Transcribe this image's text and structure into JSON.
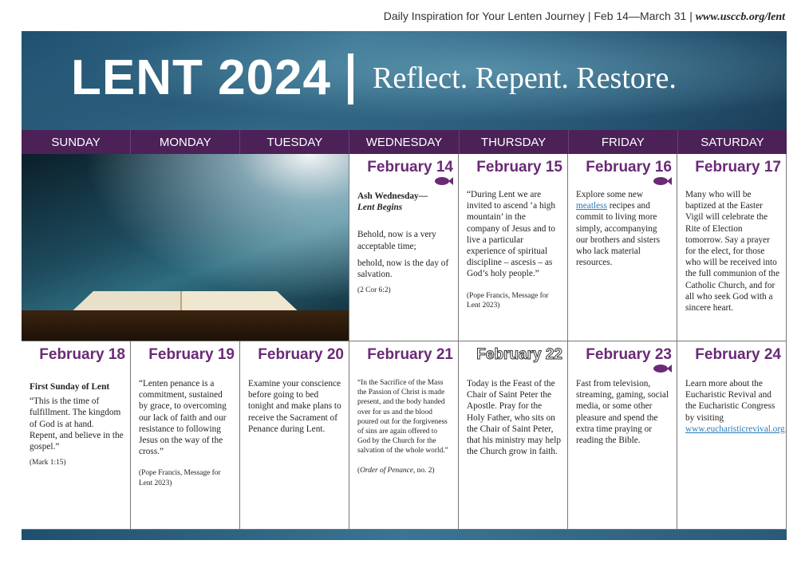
{
  "header": {
    "tagline": "Daily Inspiration for Your Lenten Journey | Feb 14—March 31 |",
    "site": "www.usccb.org/lent"
  },
  "banner": {
    "title": "LENT 2024",
    "subtitle": "Reflect. Repent. Restore."
  },
  "days": [
    "SUNDAY",
    "MONDAY",
    "TUESDAY",
    "WEDNESDAY",
    "THURSDAY",
    "FRIDAY",
    "SATURDAY"
  ],
  "colors": {
    "purple": "#4b2158",
    "date_purple": "#6a2a76",
    "link": "#2a7bb8"
  },
  "icons": {
    "meatless_day": "fish-icon"
  },
  "week1": {
    "feb14": {
      "date": "February 14",
      "heading": "Ash Wednesday—",
      "subheading": "Lent Begins",
      "line1": "Behold, now is a very acceptable time;",
      "line2": "behold, now is the day of salvation.",
      "cite": "(2 Cor 6:2)"
    },
    "feb15": {
      "date": "February 15",
      "quote": "“During Lent we are invited to ascend ‘a high mountain’ in the company of Jesus and to live a particular experience of spiritual discipline – ascesis – as God’s holy people.”",
      "cite": "(Pope Francis, Message for Lent 2023)"
    },
    "feb16": {
      "date": "February 16",
      "text_pre": "Explore some new",
      "link": "meatless",
      "text_post": "recipes and commit to living more simply, accompanying our brothers and sisters who lack material resources."
    },
    "feb17": {
      "date": "February 17",
      "text": "Many who will be baptized at the Easter Vigil will celebrate the Rite of Election tomorrow. Say a prayer for the elect, for those who will be received into the full communion of the Catholic Church, and for all who seek God with a sincere heart."
    }
  },
  "week2": {
    "feb18": {
      "date": "February 18",
      "heading": "First Sunday of Lent",
      "quote": "“This is the time of fulfillment. The kingdom of God is at hand. Repent, and believe in the gospel.”",
      "cite": "(Mark 1:15)"
    },
    "feb19": {
      "date": "February 19",
      "quote": "“Lenten penance is a commitment, sustained by grace, to overcoming our lack of faith and our resistance to following Jesus on the way of the cross.”",
      "cite": "(Pope Francis, Message for Lent 2023)"
    },
    "feb20": {
      "date": "February 20",
      "text": "Examine your conscience before going to bed tonight and make plans to receive the Sacrament of Penance during Lent."
    },
    "feb21": {
      "date": "February 21",
      "quote": "“In the Sacrifice of the Mass the Passion of Christ is made present, and the body handed over for us and the blood poured out for the forgiveness of sins are again offered to God by the Church for the salvation of the whole world.”",
      "cite_title": "Order of Penance",
      "cite_rest": ", no. 2)"
    },
    "feb22": {
      "date": "February 22",
      "text": "Today is the Feast of the Chair of Saint Peter the Apostle. Pray for the Holy Father, who sits on the Chair of Saint Peter, that his ministry may help the Church grow in faith."
    },
    "feb23": {
      "date": "February 23",
      "text": "Fast from television, streaming, gaming, social media, or some other pleasure and spend the extra time praying or reading the Bible."
    },
    "feb24": {
      "date": "February 24",
      "text": "Learn more about the Eucharistic Revival and the Eucharistic Congress by visiting",
      "link": "www.eucharisticrevival.org."
    }
  }
}
